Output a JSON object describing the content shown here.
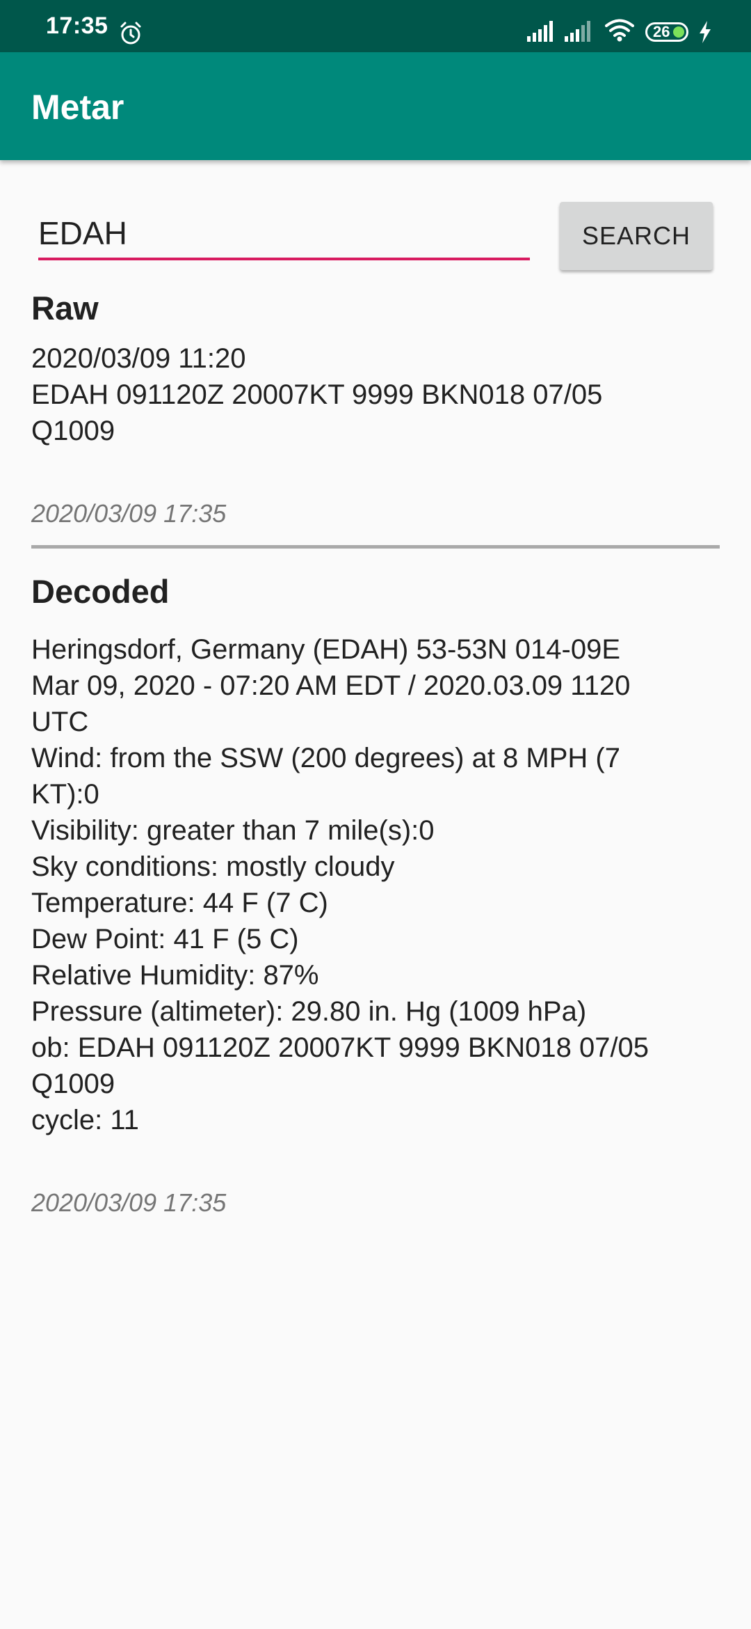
{
  "status_bar": {
    "time": "17:35",
    "battery_level": "26",
    "icons": [
      "alarm-icon",
      "signal-icon",
      "signal-icon",
      "wifi-icon",
      "battery-icon",
      "charging-icon"
    ]
  },
  "app_bar": {
    "title": "Metar"
  },
  "search": {
    "value": "EDAH",
    "button_label": "SEARCH"
  },
  "raw": {
    "heading": "Raw",
    "lines": [
      "2020/03/09 11:20",
      "EDAH 091120Z 20007KT 9999 BKN018 07/05",
      "Q1009"
    ],
    "timestamp": "2020/03/09 17:35"
  },
  "decoded": {
    "heading": "Decoded",
    "lines": [
      "Heringsdorf, Germany (EDAH) 53-53N 014-09E",
      "Mar 09, 2020 - 07:20 AM EDT / 2020.03.09 1120",
      "UTC",
      "Wind: from the SSW (200 degrees) at 8 MPH (7",
      "KT):0",
      "Visibility: greater than 7 mile(s):0",
      "Sky conditions: mostly cloudy",
      "Temperature: 44 F (7 C)",
      "Dew Point: 41 F (5 C)",
      "Relative Humidity: 87%",
      "Pressure (altimeter): 29.80 in. Hg (1009 hPa)",
      "ob: EDAH 091120Z 20007KT 9999 BKN018 07/05",
      "Q1009",
      "cycle: 11"
    ],
    "timestamp": "2020/03/09 17:35"
  },
  "colors": {
    "status_bar": "#00574b",
    "app_bar": "#00897b",
    "accent": "#d81b60",
    "background": "#fafafa"
  }
}
